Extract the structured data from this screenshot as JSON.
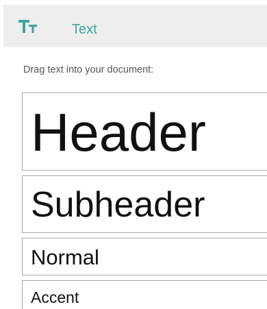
{
  "header": {
    "icon": "text-size-icon",
    "title": "Text",
    "accent_color": "#3ba79a",
    "background_color": "#eeeeee"
  },
  "instruction": "Drag text into your document:",
  "text_styles": [
    {
      "label": "Header"
    },
    {
      "label": "Subheader"
    },
    {
      "label": "Normal"
    },
    {
      "label": "Accent"
    }
  ]
}
